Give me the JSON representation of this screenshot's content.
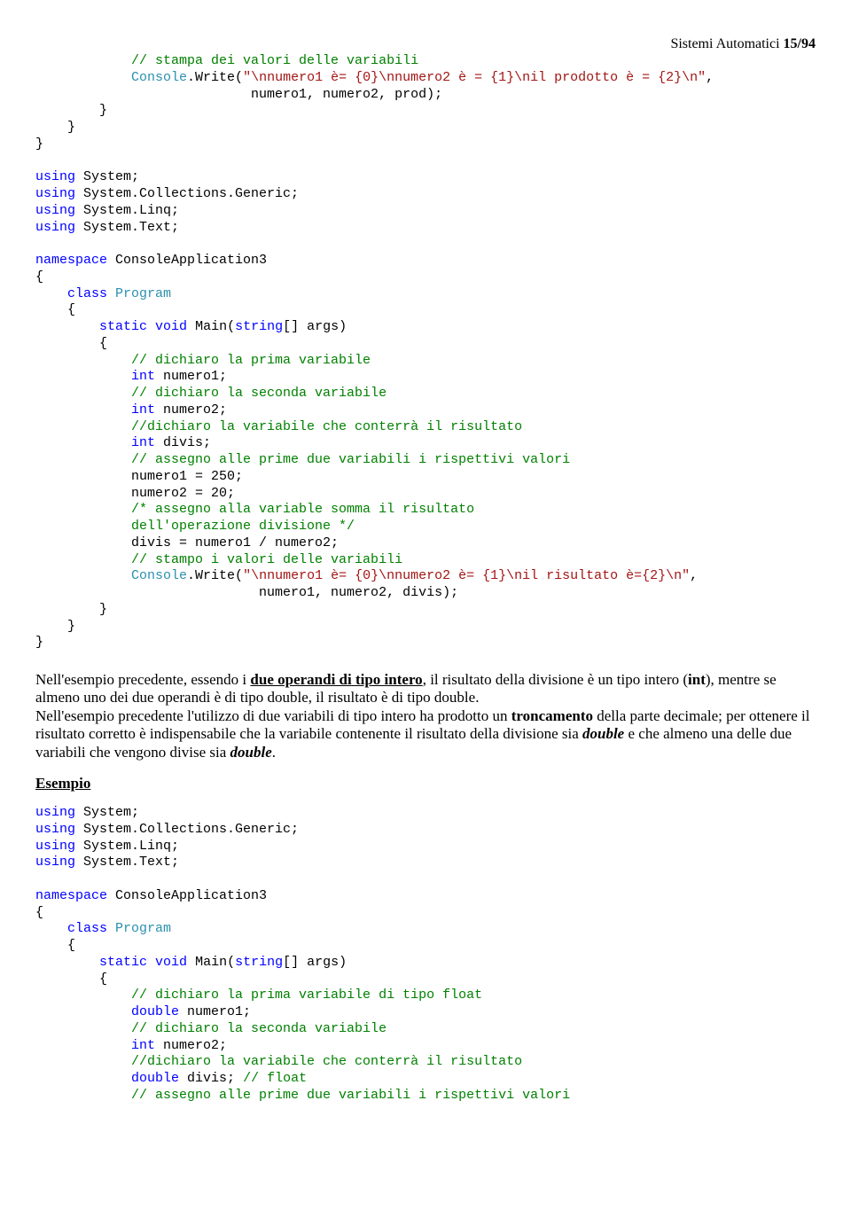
{
  "header": {
    "title_prefix": "Sistemi Automatici ",
    "page": "15/94"
  },
  "code1": {
    "l1": "            // stampa dei valori delle variabili",
    "l2a": "            ",
    "l2b": "Console",
    "l2c": ".Write(",
    "l2d": "\"\\nnumero1 è= {0}\\nnumero2 è = {1}\\nil prodotto è = {2}\\n\"",
    "l2e": ",",
    "l3": "                           numero1, numero2, prod);",
    "l4": "        }",
    "l5": "    }",
    "l6": "}",
    "blank1": "",
    "l7a": "using",
    "l7b": " System;",
    "l8a": "using",
    "l8b": " System.Collections.Generic;",
    "l9a": "using",
    "l9b": " System.Linq;",
    "l10a": "using",
    "l10b": " System.Text;",
    "blank2": "",
    "l11a": "namespace",
    "l11b": " ConsoleApplication3",
    "l12": "{",
    "l13a": "    ",
    "l13b": "class",
    "l13c": " ",
    "l13d": "Program",
    "l14": "    {",
    "l15a": "        ",
    "l15b": "static",
    "l15c": " ",
    "l15d": "void",
    "l15e": " Main(",
    "l15f": "string",
    "l15g": "[] args)",
    "l16": "        {",
    "l17": "            // dichiaro la prima variabile",
    "l18a": "            ",
    "l18b": "int",
    "l18c": " numero1;",
    "l19": "            // dichiaro la seconda variabile",
    "l20a": "            ",
    "l20b": "int",
    "l20c": " numero2;",
    "l21": "            //dichiaro la variabile che conterrà il risultato",
    "l22a": "            ",
    "l22b": "int",
    "l22c": " divis;",
    "l23": "            // assegno alle prime due variabili i rispettivi valori",
    "l24": "            numero1 = 250;",
    "l25": "            numero2 = 20;",
    "l26": "            /* assegno alla variable somma il risultato",
    "l27": "            dell'operazione divisione */",
    "l28": "            divis = numero1 / numero2;",
    "l29": "            // stampo i valori delle variabili",
    "l30a": "            ",
    "l30b": "Console",
    "l30c": ".Write(",
    "l30d": "\"\\nnumero1 è= {0}\\nnumero2 è= {1}\\nil risultato è={2}\\n\"",
    "l30e": ",",
    "l31": "                            numero1, numero2, divis);",
    "l32": "        }",
    "l33": "    }",
    "l34": "}"
  },
  "para": {
    "p1a": "Nell'esempio precedente, essendo i ",
    "p1b": "due operandi di tipo intero",
    "p1c": ", il risultato della divisione è un tipo intero (",
    "p1d": "int",
    "p1e": "), mentre se almeno uno dei due operandi è di tipo double, il risultato è di tipo double.",
    "p2a": "Nell'esempio precedente l'utilizzo di  due variabili di tipo intero ha prodotto un ",
    "p2b": "troncamento",
    "p2c": " della parte decimale; per ottenere il risultato corretto è indispensabile che la variabile contenente il risultato della divisione sia ",
    "p2d": "double",
    "p2e": " e che almeno una delle due variabili che vengono divise sia ",
    "p2f": "double",
    "p2g": "."
  },
  "esempio": "Esempio",
  "code2": {
    "l1a": "using",
    "l1b": " System;",
    "l2a": "using",
    "l2b": " System.Collections.Generic;",
    "l3a": "using",
    "l3b": " System.Linq;",
    "l4a": "using",
    "l4b": " System.Text;",
    "blank1": "",
    "l5a": "namespace",
    "l5b": " ConsoleApplication3",
    "l6": "{",
    "l7a": "    ",
    "l7b": "class",
    "l7c": " ",
    "l7d": "Program",
    "l8": "    {",
    "l9a": "        ",
    "l9b": "static",
    "l9c": " ",
    "l9d": "void",
    "l9e": " Main(",
    "l9f": "string",
    "l9g": "[] args)",
    "l10": "        {",
    "l11": "            // dichiaro la prima variabile di tipo float",
    "l12a": "            ",
    "l12b": "double",
    "l12c": " numero1;",
    "l13": "            // dichiaro la seconda variabile",
    "l14a": "            ",
    "l14b": "int",
    "l14c": " numero2;",
    "l15": "            //dichiaro la variabile che conterrà il risultato",
    "l16a": "            ",
    "l16b": "double",
    "l16c": " divis; ",
    "l16d": "// float",
    "l17": "            // assegno alle prime due variabili i rispettivi valori"
  }
}
